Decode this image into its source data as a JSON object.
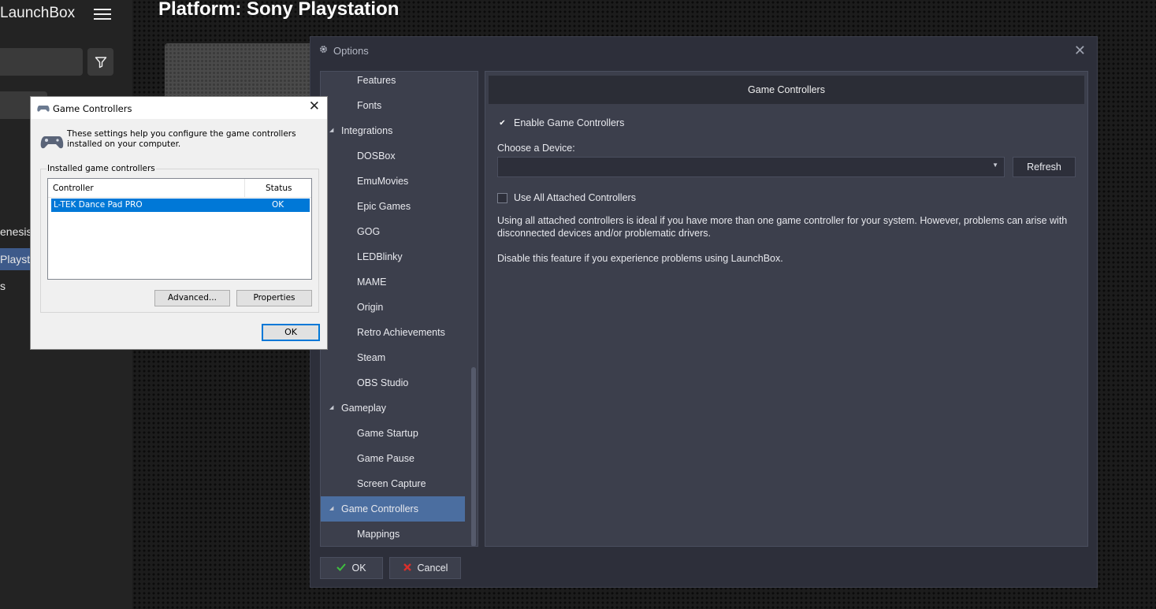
{
  "launchbox": {
    "app_title": "LaunchBox",
    "platform_title": "Platform: Sony Playstation",
    "sidebar_items": [
      "enesis",
      "Playstatio",
      "s"
    ]
  },
  "options": {
    "window_title": "Options",
    "nav_items": [
      {
        "label": "Features",
        "level": 1
      },
      {
        "label": "Fonts",
        "level": 1
      },
      {
        "label": "Integrations",
        "level": 0,
        "expanded": true
      },
      {
        "label": "DOSBox",
        "level": 1
      },
      {
        "label": "EmuMovies",
        "level": 1
      },
      {
        "label": "Epic Games",
        "level": 1
      },
      {
        "label": "GOG",
        "level": 1
      },
      {
        "label": "LEDBlinky",
        "level": 1
      },
      {
        "label": "MAME",
        "level": 1
      },
      {
        "label": "Origin",
        "level": 1
      },
      {
        "label": "Retro Achievements",
        "level": 1
      },
      {
        "label": "Steam",
        "level": 1
      },
      {
        "label": "OBS Studio",
        "level": 1
      },
      {
        "label": "Gameplay",
        "level": 0,
        "expanded": true
      },
      {
        "label": "Game Startup",
        "level": 1
      },
      {
        "label": "Game Pause",
        "level": 1
      },
      {
        "label": "Screen Capture",
        "level": 1
      },
      {
        "label": "Game Controllers",
        "level": 0,
        "expanded": true,
        "selected": true
      },
      {
        "label": "Mappings",
        "level": 1
      }
    ],
    "content": {
      "title": "Game Controllers",
      "enable_label": "Enable Game Controllers",
      "enable_checked": true,
      "device_label": "Choose a Device:",
      "device_value": "",
      "refresh_label": "Refresh",
      "use_all_label": "Use All Attached Controllers",
      "use_all_checked": false,
      "description": "Using all attached controllers is ideal if you have more than one game controller for your system. However, problems can arise with disconnected devices and/or problematic drivers.",
      "note": "Disable this feature if you experience problems using LaunchBox."
    },
    "ok_label": "OK",
    "cancel_label": "Cancel"
  },
  "game_controllers_dialog": {
    "title": "Game Controllers",
    "intro": "These settings help you configure the game controllers installed on your computer.",
    "group_label": "Installed game controllers",
    "columns": {
      "controller": "Controller",
      "status": "Status"
    },
    "rows": [
      {
        "controller": "L-TEK Dance Pad PRO",
        "status": "OK"
      }
    ],
    "advanced_label": "Advanced...",
    "properties_label": "Properties",
    "ok_label": "OK"
  },
  "colors": {
    "selection_blue": "#4b6ea0",
    "windows_accent": "#0078d7",
    "ok_green": "#3fbf3f",
    "cancel_red": "#d9302c"
  }
}
